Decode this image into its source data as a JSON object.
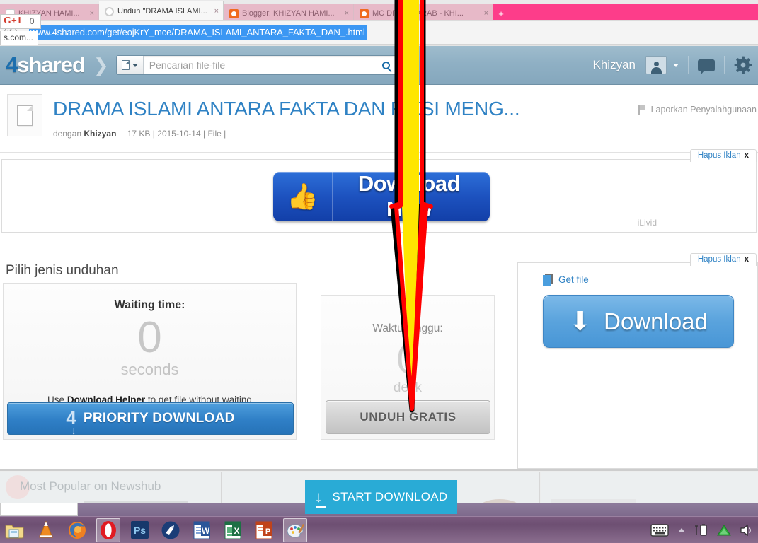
{
  "browser": {
    "tabs": [
      {
        "title": "KHIZYAN HAMI...",
        "close": "×",
        "favicon": "blank-favicon",
        "state": "inactive"
      },
      {
        "title": "Unduh \"DRAMA ISLAMI...",
        "close": "×",
        "favicon": "loading-spinner-favicon",
        "state": "active"
      },
      {
        "title": "Blogger: KHIZYAN HAMI...",
        "close": "×",
        "favicon": "blogger-favicon",
        "state": "inactive"
      },
      {
        "title": "MC DRAMA ARAB - KHI...",
        "close": "×",
        "favicon": "blogger-favicon",
        "state": "inactive"
      }
    ],
    "new_tab_label": "+",
    "url": "www.4shared.com/get/eojKrY_mce/DRAMA_ISLAMI_ANTARA_FAKTA_DAN_.html",
    "page_action_icon": "page-info-icon",
    "url_selected": true
  },
  "site_header": {
    "logo_number": "4",
    "logo_text": "shared",
    "search_placeholder": "Pencarian file-file",
    "search_value": "",
    "search_type_icon": "document-filter-icon",
    "search_button_icon": "search-icon",
    "username": "Khizyan",
    "avatar_icon": "user-avatar-icon",
    "avatar_caret_icon": "chevron-down-icon",
    "messages_icon": "chat-bubble-icon",
    "settings_icon": "gear-icon"
  },
  "file_info": {
    "icon": "file-document-icon",
    "title": "DRAMA ISLAMI ANTARA FAKTA DAN FIKSI MENG...",
    "meta_prefix": "dengan",
    "owner": "Khizyan",
    "size": "17 KB",
    "date": "2015-10-14",
    "type": "File",
    "report_icon": "flag-icon",
    "report_label": "Laporkan Penyalahgunaan"
  },
  "ads": {
    "remove_ad_label": "Hapus Iklan",
    "remove_ad_close": "x",
    "banner": {
      "thumbs_icon": "thumbs-up-icon",
      "button_label": "Download Now",
      "provider": "iLivid"
    }
  },
  "main": {
    "section_title": "Pilih jenis unduhan",
    "left_panel": {
      "waiting_label": "Waiting time:",
      "waiting_value": "0",
      "waiting_unit": "seconds",
      "helper_prefix": "Use",
      "helper_bold": "Download Helper",
      "helper_suffix": "to get file without waiting",
      "priority_number": "4",
      "priority_arrow_icon": "download-arrow-icon",
      "priority_label": "PRIORITY DOWNLOAD"
    },
    "mid_panel": {
      "waiting_label": "Waktu tunggu:",
      "waiting_value": "0",
      "waiting_unit": "detik",
      "free_button_label": "UNDUH GRATIS"
    },
    "right_panel": {
      "get_file_icon": "blue-file-icon",
      "get_file_label": "Get file",
      "download_arrow_icon": "download-arrow-icon",
      "download_label": "Download"
    }
  },
  "bottom_strip": {
    "newshub_title": "Most Popular on Newshub",
    "gplus_label": "G+1",
    "gplus_count": "0",
    "gplus_tooltip": "s.com...",
    "start_download_icon": "download-arrow-icon",
    "start_download_label": "START DOWNLOAD"
  },
  "taskbar": {
    "items": [
      {
        "name": "file-explorer-icon",
        "running": false
      },
      {
        "name": "vlc-media-player-icon",
        "running": false
      },
      {
        "name": "firefox-icon",
        "running": false
      },
      {
        "name": "opera-browser-icon",
        "running": true
      },
      {
        "name": "photoshop-icon",
        "running": false
      },
      {
        "name": "winamp-icon",
        "running": false
      },
      {
        "name": "microsoft-word-icon",
        "running": false
      },
      {
        "name": "microsoft-excel-icon",
        "running": false
      },
      {
        "name": "microsoft-powerpoint-icon",
        "running": false
      },
      {
        "name": "paint-icon",
        "running": true
      }
    ],
    "tray": [
      {
        "name": "on-screen-keyboard-icon"
      },
      {
        "name": "show-hidden-icons-icon"
      },
      {
        "name": "battery-icon"
      },
      {
        "name": "hardware-safely-remove-icon"
      },
      {
        "name": "volume-speaker-icon"
      }
    ]
  },
  "annotation": {
    "shape": "downward-pointing-arrow",
    "outline_color": "#ff0000",
    "shadow_color": "#000000",
    "fill_color": "#ffe600"
  }
}
